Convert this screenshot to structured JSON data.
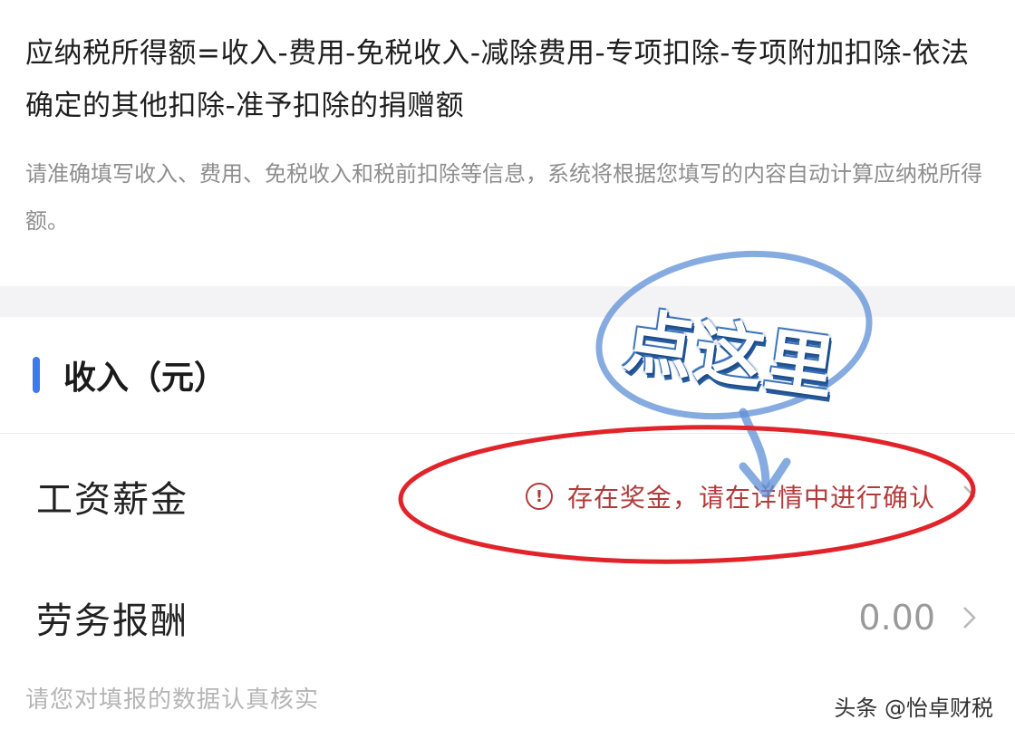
{
  "formula": "应纳税所得额=收入-费用-免税收入-减除费用-专项扣除-专项附加扣除-依法确定的其他扣除-准予扣除的捐赠额",
  "description": "请准确填写收入、费用、免税收入和税前扣除等信息，系统将根据您填写的内容自动计算应纳税所得额。",
  "section": {
    "title": "收入（元）"
  },
  "rows": [
    {
      "label": "工资薪金",
      "warning_icon": "!",
      "warning": "存在奖金，请在详情中进行确认"
    },
    {
      "label": "劳务报酬",
      "value": "0.00"
    }
  ],
  "footnote": "请您对填报的数据认真核实",
  "annotation": {
    "stamp_text": "点这里"
  },
  "watermark": "头条 @怡卓财税",
  "colors": {
    "accent": "#3d7bea",
    "warning": "#b33a3a",
    "annotation_red": "#e0242a",
    "annotation_blue": "#5d8fd6"
  }
}
